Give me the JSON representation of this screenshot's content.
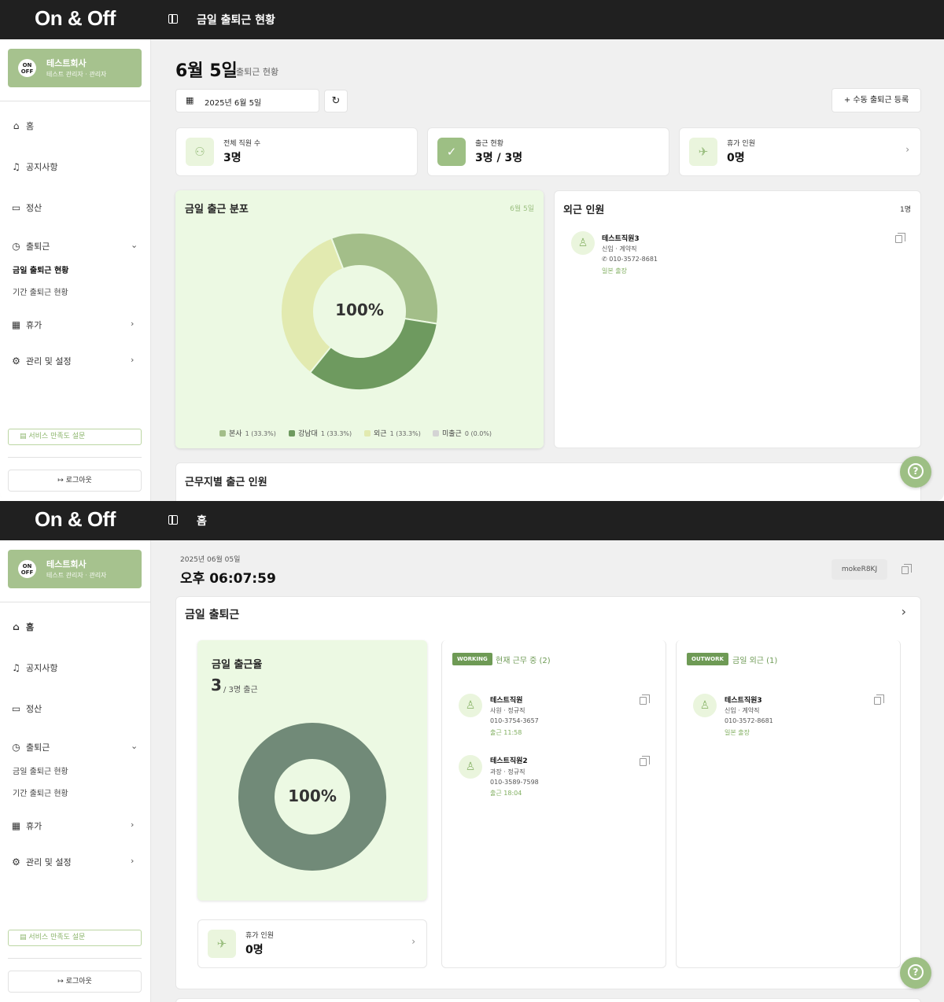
{
  "app": {
    "logo": "On & Off"
  },
  "sidebar": {
    "company_name": "테스트회사",
    "company_role": "테스트 관리자 · 관리자",
    "badge": "ON OFF",
    "items": {
      "home": "홈",
      "notice": "공지사항",
      "settlement": "정산",
      "attendance": "출퇴근",
      "today_attendance": "금일 출퇴근 현황",
      "period_attendance": "기간 출퇴근 현황",
      "vacation": "휴가",
      "management": "관리 및 설정"
    },
    "survey": "서비스 만족도 설문",
    "logout": "로그아웃"
  },
  "screen1": {
    "page_title": "금일 출퇴근 현황",
    "date_heading": "6월 5일",
    "date_sub": "출퇴근 현황",
    "date_picker": "2025년 6월 5일",
    "manual_button": "수동 출퇴근 등록",
    "stats": [
      {
        "label": "전체 직원 수",
        "value": "3명",
        "icon": "users-icon"
      },
      {
        "label": "출근 현황",
        "value": "3명 / 3명",
        "icon": "user-check-icon"
      },
      {
        "label": "휴가 인원",
        "value": "0명",
        "icon": "plane-icon"
      }
    ],
    "distribution": {
      "title": "금일 출근 분포",
      "date": "6월 5일",
      "center": "100%",
      "legend": [
        {
          "name": "본사",
          "value": "1 (33.3%)",
          "color": "#a3be89"
        },
        {
          "name": "강남대",
          "value": "1 (33.3%)",
          "color": "#6e9a5f"
        },
        {
          "name": "외근",
          "value": "1 (33.3%)",
          "color": "#e2eab0"
        },
        {
          "name": "미출근",
          "value": "0 (0.0%)",
          "color": "#d4d4d4"
        }
      ]
    },
    "chart_data": {
      "type": "pie",
      "title": "금일 출근 분포",
      "categories": [
        "본사",
        "강남대",
        "외근",
        "미출근"
      ],
      "values": [
        1,
        1,
        1,
        0
      ],
      "colors": [
        "#a3be89",
        "#6e9a5f",
        "#e2eab0",
        "#d4d4d4"
      ]
    },
    "outwork": {
      "title": "외근 인원",
      "count": "1명",
      "person": {
        "name": "테스트직원3",
        "meta": "신입 · 계약직",
        "phone": "010-3572-8681",
        "status": "일본 출장"
      }
    },
    "location_title": "근무지별 출근 인원"
  },
  "screen2": {
    "page_title": "홈",
    "date_line": "2025년 06월 05일",
    "time": "오후 06:07:59",
    "code": "mokeR8KJ",
    "section_title": "금일 출퇴근",
    "rate": {
      "title": "금일 출근율",
      "count": "3",
      "suffix": "/ 3명 출근",
      "center": "100%",
      "percent": 100
    },
    "vacation": {
      "label": "휴가 인원",
      "value": "0명"
    },
    "working": {
      "tag": "WORKING",
      "label": "현재 근무 중 (2)",
      "people": [
        {
          "name": "테스트직원",
          "meta": "사원 · 정규직",
          "phone": "010-3754-3657",
          "status": "출근 11:58"
        },
        {
          "name": "테스트직원2",
          "meta": "과장 · 정규직",
          "phone": "010-3589-7598",
          "status": "출근 18:04"
        }
      ]
    },
    "outwork": {
      "tag": "OUTWORK",
      "label": "금일 외근 (1)",
      "people": [
        {
          "name": "테스트직원3",
          "meta": "신입 · 계약직",
          "phone": "010-3572-8681",
          "status": "일본 출장"
        }
      ]
    }
  }
}
